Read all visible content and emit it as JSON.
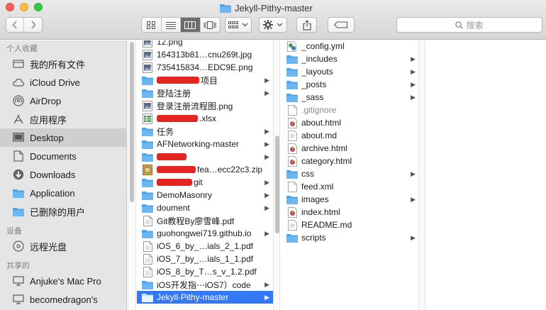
{
  "window": {
    "title": "Jekyll-Pithy-master"
  },
  "toolbar": {
    "view_buttons": [
      "icon-view-icon",
      "list-view-icon",
      "column-view-icon",
      "coverflow-view-icon"
    ],
    "search_placeholder": "搜索"
  },
  "sidebar": {
    "favorites_header": "个人收藏",
    "favorites": [
      {
        "label": "我的所有文件",
        "icon": "all-files-icon"
      },
      {
        "label": "iCloud Drive",
        "icon": "cloud-icon"
      },
      {
        "label": "AirDrop",
        "icon": "airdrop-icon"
      },
      {
        "label": "应用程序",
        "icon": "applications-icon"
      },
      {
        "label": "Desktop",
        "icon": "desktop-icon",
        "selected": true
      },
      {
        "label": "Documents",
        "icon": "documents-icon"
      },
      {
        "label": "Downloads",
        "icon": "downloads-icon"
      },
      {
        "label": "Application",
        "icon": "folder-icon"
      },
      {
        "label": "已删除的用户",
        "icon": "folder-icon"
      }
    ],
    "devices_header": "设备",
    "devices": [
      {
        "label": "远程光盘",
        "icon": "disc-icon"
      }
    ],
    "shared_header": "共享的",
    "shared": [
      {
        "label": "Anjuke's Mac Pro",
        "icon": "computer-icon"
      },
      {
        "label": "becomedragon's",
        "icon": "computer-icon"
      }
    ]
  },
  "column2": {
    "items": [
      {
        "label": "12.png",
        "icon": "image-file-icon"
      },
      {
        "label": "164313b81…cnu269t.jpg",
        "icon": "image-file-icon"
      },
      {
        "label": "735415834…EDC9E.png",
        "icon": "image-file-icon"
      },
      {
        "label": "项目",
        "icon": "folder-icon",
        "folder": true,
        "redacted": true
      },
      {
        "label": "登陆注册",
        "icon": "folder-icon",
        "folder": true
      },
      {
        "label": "登录注册流程图.png",
        "icon": "image-file-icon"
      },
      {
        "label": ".xlsx",
        "icon": "spreadsheet-icon",
        "redacted": true
      },
      {
        "label": "任务",
        "icon": "folder-icon",
        "folder": true
      },
      {
        "label": "AFNetworking-master",
        "icon": "folder-icon",
        "folder": true
      },
      {
        "label": "",
        "icon": "folder-icon",
        "folder": true,
        "redacted": true
      },
      {
        "label": "fea…ecc22c3.zip",
        "icon": "zip-icon",
        "redacted": true
      },
      {
        "label": "git",
        "icon": "folder-icon",
        "folder": true,
        "redacted": true
      },
      {
        "label": "DemoMasonry",
        "icon": "folder-icon",
        "folder": true
      },
      {
        "label": "doument",
        "icon": "folder-icon",
        "folder": true
      },
      {
        "label": "Git教程By廖雪峰.pdf",
        "icon": "pdf-icon"
      },
      {
        "label": "guohongwei719.github.io",
        "icon": "folder-icon",
        "folder": true
      },
      {
        "label": "iOS_6_by_…ials_2_1.pdf",
        "icon": "pdf-icon"
      },
      {
        "label": "iOS_7_by_…ials_1_1.pdf",
        "icon": "pdf-icon"
      },
      {
        "label": "iOS_8_by_T…s_v_1.2.pdf",
        "icon": "pdf-icon"
      },
      {
        "label": "iOS开发指⋯iOS7）code",
        "icon": "folder-icon",
        "folder": true
      },
      {
        "label": "Jekyll-Pithy-master",
        "icon": "folder-icon",
        "folder": true,
        "selected": true
      }
    ]
  },
  "column3": {
    "items": [
      {
        "label": "_config.yml",
        "icon": "yml-file-icon"
      },
      {
        "label": "_includes",
        "icon": "folder-icon",
        "folder": true
      },
      {
        "label": "_layouts",
        "icon": "folder-icon",
        "folder": true
      },
      {
        "label": "_posts",
        "icon": "folder-icon",
        "folder": true
      },
      {
        "label": "_sass",
        "icon": "folder-icon",
        "folder": true
      },
      {
        "label": ".gitignore",
        "icon": "text-file-icon",
        "dim": true
      },
      {
        "label": "about.html",
        "icon": "html-file-icon"
      },
      {
        "label": "about.md",
        "icon": "md-file-icon"
      },
      {
        "label": "archive.html",
        "icon": "html-file-icon"
      },
      {
        "label": "category.html",
        "icon": "html-file-icon"
      },
      {
        "label": "css",
        "icon": "folder-icon",
        "folder": true
      },
      {
        "label": "feed.xml",
        "icon": "text-file-icon"
      },
      {
        "label": "images",
        "icon": "folder-icon",
        "folder": true
      },
      {
        "label": "index.html",
        "icon": "html-file-icon"
      },
      {
        "label": "README.md",
        "icon": "md-file-icon"
      },
      {
        "label": "scripts",
        "icon": "folder-icon",
        "folder": true
      }
    ]
  }
}
